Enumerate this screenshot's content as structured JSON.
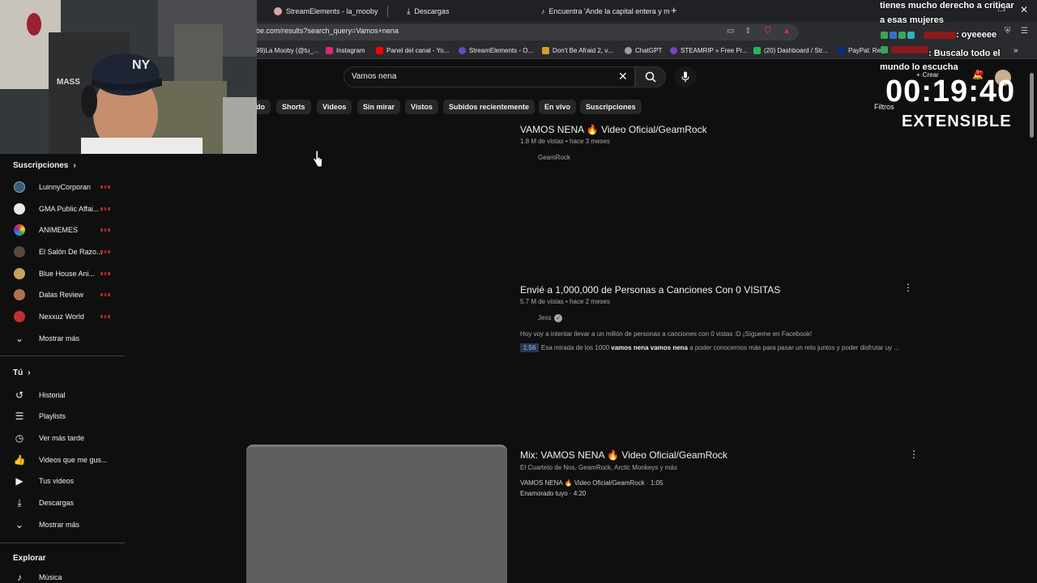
{
  "browser": {
    "tabs": [
      {
        "title": "StreamElements - la_mooby"
      },
      {
        "title": "Descargas"
      },
      {
        "title": "Encuentra 'Ande la capital entera y m"
      }
    ],
    "new_tab": "+",
    "url": "be.com/results?search_query=Vamos+nena",
    "bookmarks": [
      {
        "label": "99)La Mooby (@tu_...",
        "color": "#e0245e"
      },
      {
        "label": "Instagram",
        "color": "#d62976"
      },
      {
        "label": "Panel del canal - Yo...",
        "color": "#ff0000"
      },
      {
        "label": "StreamElements - O...",
        "color": "#5a4fcf"
      },
      {
        "label": "Don't Be Afraid 2, v...",
        "color": "#d89a2b"
      },
      {
        "label": "ChatGPT",
        "color": "#9aa0a6"
      },
      {
        "label": "STEAMRIP » Free Pr...",
        "color": "#7b3fd4"
      },
      {
        "label": "(20) Dashboard / Str...",
        "color": "#1db954"
      },
      {
        "label": "PayPal: Res",
        "color": "#003087"
      }
    ]
  },
  "search": {
    "query": "Vamos nena"
  },
  "chips": [
    "do",
    "Shorts",
    "Videos",
    "Sin mirar",
    "Vistos",
    "Subidos recientemente",
    "En vivo",
    "Suscripciones"
  ],
  "filters_label": "Filtros",
  "sidebar": {
    "subscriptions_title": "Suscripciones",
    "subscriptions": [
      {
        "label": "LuinnyCorporan",
        "color": "#3a5a7a"
      },
      {
        "label": "GMA Public Affai...",
        "color": "#e8e8e8"
      },
      {
        "label": "ANIMEMES",
        "color": "#4caf50"
      },
      {
        "label": "El Salón De Razo...",
        "color": "#5a4a3a"
      },
      {
        "label": "Blue House Ani...",
        "color": "#c8a060"
      },
      {
        "label": "Dalas Review",
        "color": "#b07050"
      },
      {
        "label": "Nexxuz World",
        "color": "#c03030"
      }
    ],
    "show_more_1": "Mostrar más",
    "you_title": "Tú",
    "you_items": [
      {
        "label": "Historial",
        "icon": "history-icon"
      },
      {
        "label": "Playlists",
        "icon": "playlist-icon"
      },
      {
        "label": "Ver más tarde",
        "icon": "clock-icon"
      },
      {
        "label": "Videos que me gus...",
        "icon": "thumbs-up-icon"
      },
      {
        "label": "Tus videos",
        "icon": "play-icon"
      },
      {
        "label": "Descargas",
        "icon": "download-icon"
      }
    ],
    "show_more_2": "Mostrar más",
    "explore_title": "Explorar",
    "explore_items": [
      {
        "label": "Música",
        "icon": "music-icon"
      }
    ]
  },
  "results": [
    {
      "title": "VAMOS NENA 🔥 Video Oficial/GeamRock",
      "meta": "1.8 M de vistas • hace 3 meses",
      "channel": "GeamRock"
    },
    {
      "title": "Envié a 1,000,000 de Personas a Canciones Con 0 VISITAS",
      "meta": "5.7 M de vistas • hace 2 meses",
      "channel": "Jexs",
      "verified": "✓",
      "description": "Hoy voy a intentar llevar a un millón de personas a canciones con 0 vistas :D ¡Sígueme en Facebook!",
      "timestamp": "1:56",
      "chapter_pre": "Esa mirada de los 1000 ",
      "chapter_bold": "vamos nena vamos nena",
      "chapter_post": " a poder conocernos más para pasar un reto juntos y poder disfrutar uy ..."
    },
    {
      "title": "Mix: VAMOS NENA 🔥 Video Oficial/GeamRock",
      "meta": "El Cuarteto de Nos, GeamRock, Arctic Monkeys y más",
      "line1": "VAMOS NENA 🔥 Video Oficial/GeamRock · 1:05",
      "line2": "Enamorado tuyo · 4:20"
    }
  ],
  "overlay": {
    "chat_line1": "tienes mucho derecho a criticar",
    "chat_line2": "a esas mujeres",
    "chat_line3": ": oyeeeee",
    "chat_line4": ": Buscalo todo el",
    "chat_line5": "mundo lo escucha",
    "timer": "00:19:40",
    "extensible": "EXTENSIBLE",
    "create_label": "Crear",
    "notif_badge": "9+",
    "cap_text": "NY",
    "wall_text": "MASS"
  }
}
